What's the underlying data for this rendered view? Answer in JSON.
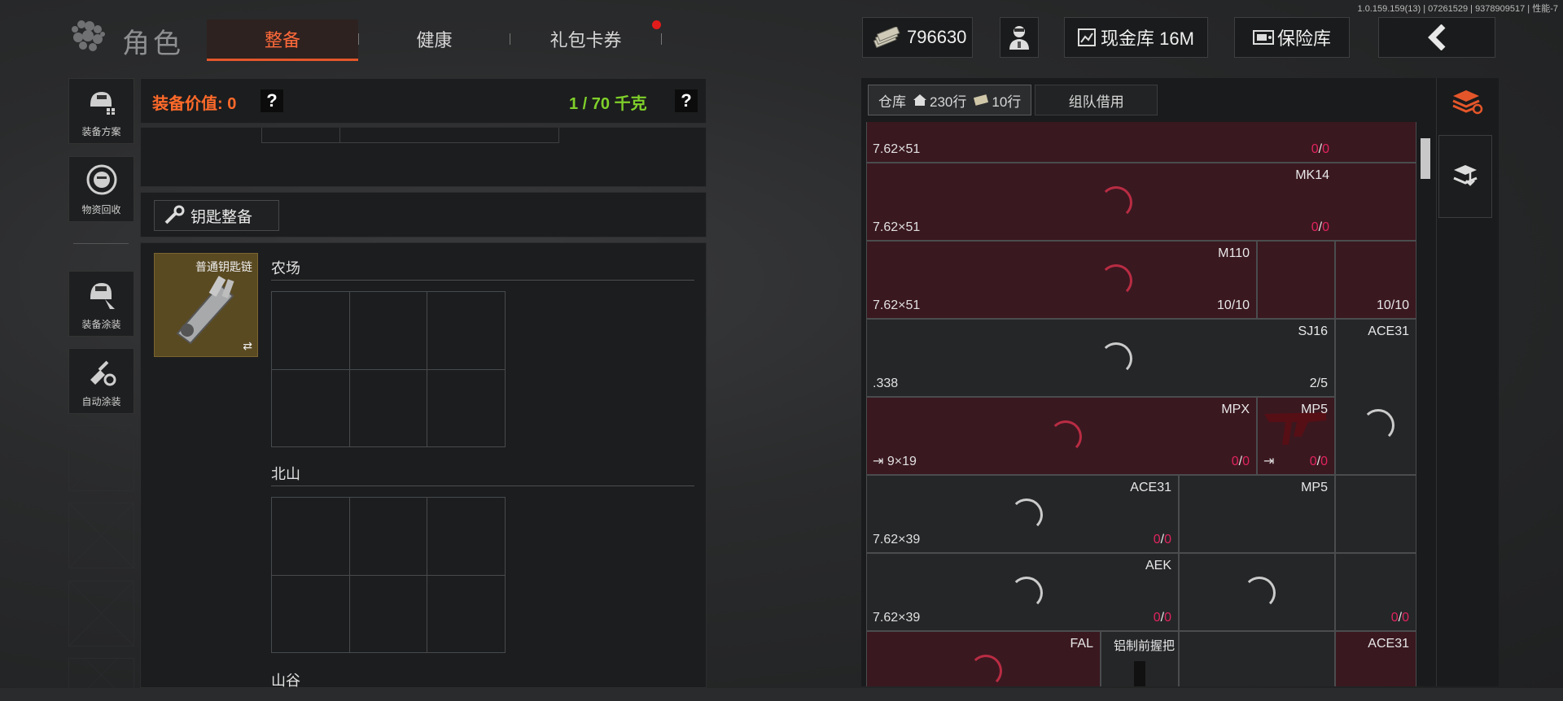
{
  "version": "1.0.159.159(13) | 07261529 | 9378909517 | 性能-7",
  "header": {
    "title": "角色",
    "tabs": [
      {
        "label": "整备",
        "active": true
      },
      {
        "label": "健康",
        "active": false
      },
      {
        "label": "礼包卡券",
        "active": false,
        "badge": true
      }
    ],
    "money": "796630",
    "cash_vault": "现金库 16M",
    "safe_box": "保险库",
    "accent": "#e4562a"
  },
  "left_rail": [
    {
      "label": "装备方案",
      "icon": "helmet-plan-icon"
    },
    {
      "label": "物资回收",
      "icon": "recycle-face-icon"
    },
    {
      "label": "装备涂装",
      "icon": "helmet-paint-icon"
    },
    {
      "label": "自动涂装",
      "icon": "brush-gear-icon"
    }
  ],
  "equipment": {
    "value_label": "装备价值: 0",
    "weight_label": "1 / 70 千克",
    "help": "?",
    "key_button": "钥匙整备",
    "keychain_label": "普通钥匙链",
    "swap": "⇄",
    "sections": [
      "农场",
      "北山",
      "山谷"
    ]
  },
  "warehouse": {
    "tab_label": "仓库",
    "rows_home": "230行",
    "rows_extra": "10行",
    "team_borrow": "组队借用",
    "cells": [
      {
        "cal": "7.62×51",
        "name": "",
        "count_a": "0",
        "count_b": "0",
        "color": "red",
        "row": 0
      },
      {
        "cal": "7.62×51",
        "name": "MK14",
        "count_a": "0",
        "count_b": "0",
        "color": "red",
        "row": 1
      },
      {
        "cal": "7.62×51",
        "name": "M110",
        "count": "10/10",
        "count2": "10/10",
        "color": "red",
        "row": 2
      },
      {
        "cal": ".338",
        "name": "SJ16",
        "count": "2/5",
        "name2": "ACE31",
        "color": "dark",
        "row": 3
      },
      {
        "cal": "9×19",
        "name": "MPX",
        "count_a": "0",
        "count_b": "0",
        "name2": "MP5",
        "count2_a": "0",
        "count2_b": "0",
        "color": "red",
        "row": 4
      },
      {
        "cal": "7.62×39",
        "name": "ACE31",
        "count_a": "0",
        "count_b": "0",
        "name2": "MP5",
        "color": "dark",
        "row": 5
      },
      {
        "cal": "7.62×39",
        "name": "AEK",
        "count_a": "0",
        "count_b": "0",
        "count2_a": "0",
        "count2_b": "0",
        "color": "dark",
        "row": 6
      },
      {
        "name": "FAL",
        "name2": "铝制前握把",
        "name3": "ACE31",
        "color": "red",
        "row": 7
      }
    ]
  }
}
